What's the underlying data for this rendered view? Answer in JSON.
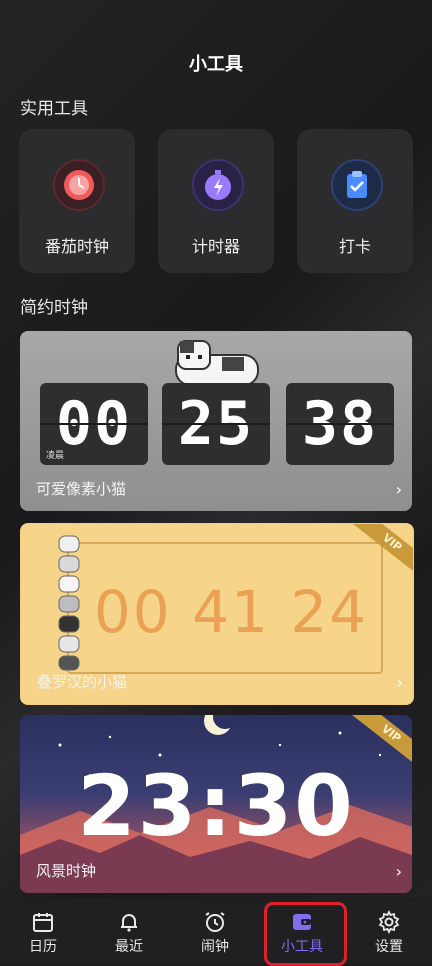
{
  "header": {
    "title": "小工具"
  },
  "sections": {
    "tools": "实用工具",
    "clocks": "简约时钟"
  },
  "tools": [
    {
      "label": "番茄时钟",
      "icon": "tomato-clock-icon",
      "color": "#e94a4a"
    },
    {
      "label": "计时器",
      "icon": "stopwatch-icon",
      "color": "#7b5cf0"
    },
    {
      "label": "打卡",
      "icon": "clipboard-check-icon",
      "color": "#3a7bf0"
    }
  ],
  "clocks": {
    "pixel": {
      "label": "可爱像素小猫",
      "hh": "00",
      "mm": "25",
      "ss": "38",
      "ampm": "凌晨"
    },
    "stack": {
      "label": "叠罗汉的小猫",
      "time": "00 41 24",
      "badge": "VIP"
    },
    "scene": {
      "label": "风景时钟",
      "time": "23:30",
      "badge": "VIP"
    }
  },
  "chevron": "›",
  "tabbar": [
    {
      "label": "日历",
      "icon": "calendar-icon"
    },
    {
      "label": "最近",
      "icon": "bell-icon"
    },
    {
      "label": "闹钟",
      "icon": "alarm-clock-icon"
    },
    {
      "label": "小工具",
      "icon": "wallet-icon",
      "active": true
    },
    {
      "label": "设置",
      "icon": "gear-icon"
    }
  ]
}
